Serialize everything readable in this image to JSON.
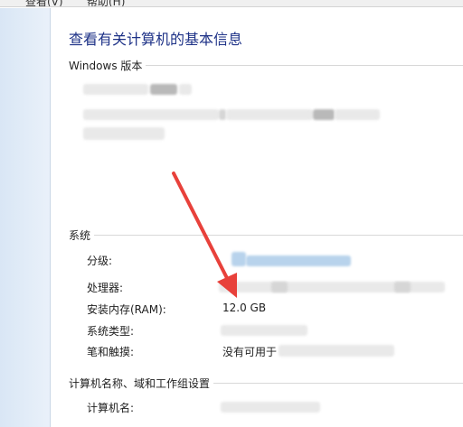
{
  "menu": {
    "items": [
      "查看(V)",
      "帮助(H)"
    ]
  },
  "page": {
    "title": "查看有关计算机的基本信息"
  },
  "sections": {
    "windows": "Windows 版本",
    "system": "系统",
    "computer": "计算机名称、域和工作组设置"
  },
  "system": {
    "rating_label": "分级:",
    "processor_label": "处理器:",
    "ram_label": "安装内存(RAM):",
    "ram_value": "12.0 GB",
    "type_label": "系统类型:",
    "pen_label": "笔和触摸:",
    "pen_value": "没有可用于"
  },
  "computer": {
    "name_label": "计算机名:"
  },
  "colors": {
    "title": "#1e3287",
    "arrow": "#e8413b",
    "left_pane": "#dfeaf7"
  }
}
